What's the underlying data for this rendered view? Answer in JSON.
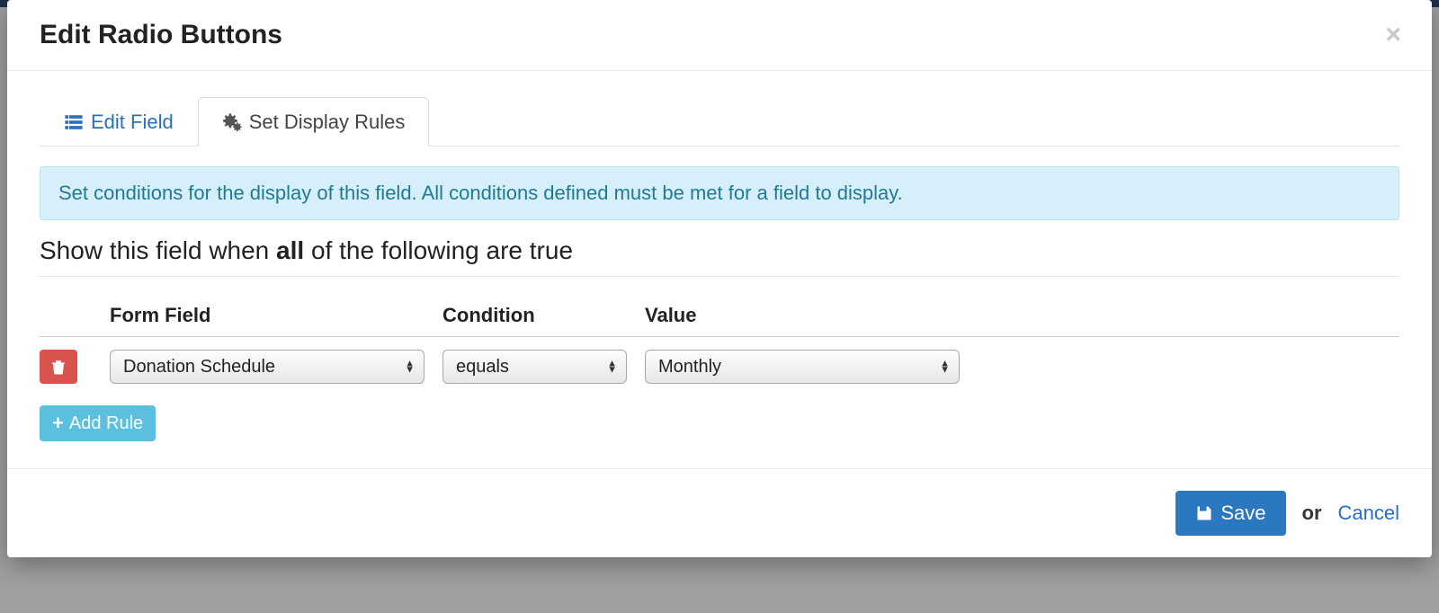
{
  "modal": {
    "title": "Edit Radio Buttons",
    "close_aria": "Close"
  },
  "tabs": {
    "edit_field": "Edit Field",
    "set_rules": "Set Display Rules"
  },
  "info_banner": "Set conditions for the display of this field. All conditions defined must be met for a field to display.",
  "section": {
    "prefix": "Show this field when ",
    "emph": "all",
    "suffix": " of the following are true"
  },
  "columns": {
    "form_field": "Form Field",
    "condition": "Condition",
    "value": "Value"
  },
  "rules": [
    {
      "field": "Donation Schedule",
      "condition": "equals",
      "value": "Monthly"
    }
  ],
  "buttons": {
    "add_rule": "Add Rule",
    "save": "Save",
    "or": "or",
    "cancel": "Cancel"
  },
  "colors": {
    "primary": "#2b77c0",
    "info_bg": "#d7effa",
    "info_text": "#1f7b94",
    "add_btn": "#5bc0de",
    "danger": "#d9534f",
    "link": "#2a6fbf"
  }
}
